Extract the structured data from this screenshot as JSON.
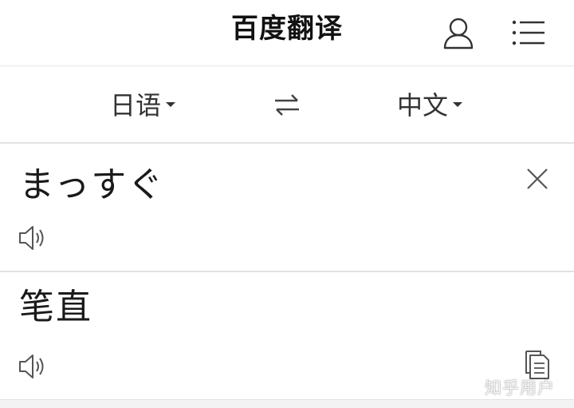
{
  "header": {
    "title": "百度翻译",
    "user_icon": "user-icon",
    "menu_icon": "menu-icon"
  },
  "languages": {
    "source": "日语",
    "target": "中文",
    "swap_icon": "swap-arrows-icon"
  },
  "source_panel": {
    "text": "まっすぐ",
    "speaker_icon": "speaker-icon",
    "clear_icon": "close-icon"
  },
  "result_panel": {
    "text": "笔直",
    "speaker_icon": "speaker-icon",
    "copy_icon": "copy-icon"
  },
  "watermark": {
    "text": "知乎用户"
  },
  "colors": {
    "text_primary": "#222222",
    "divider": "#e2e2e2",
    "icon": "#444444"
  }
}
